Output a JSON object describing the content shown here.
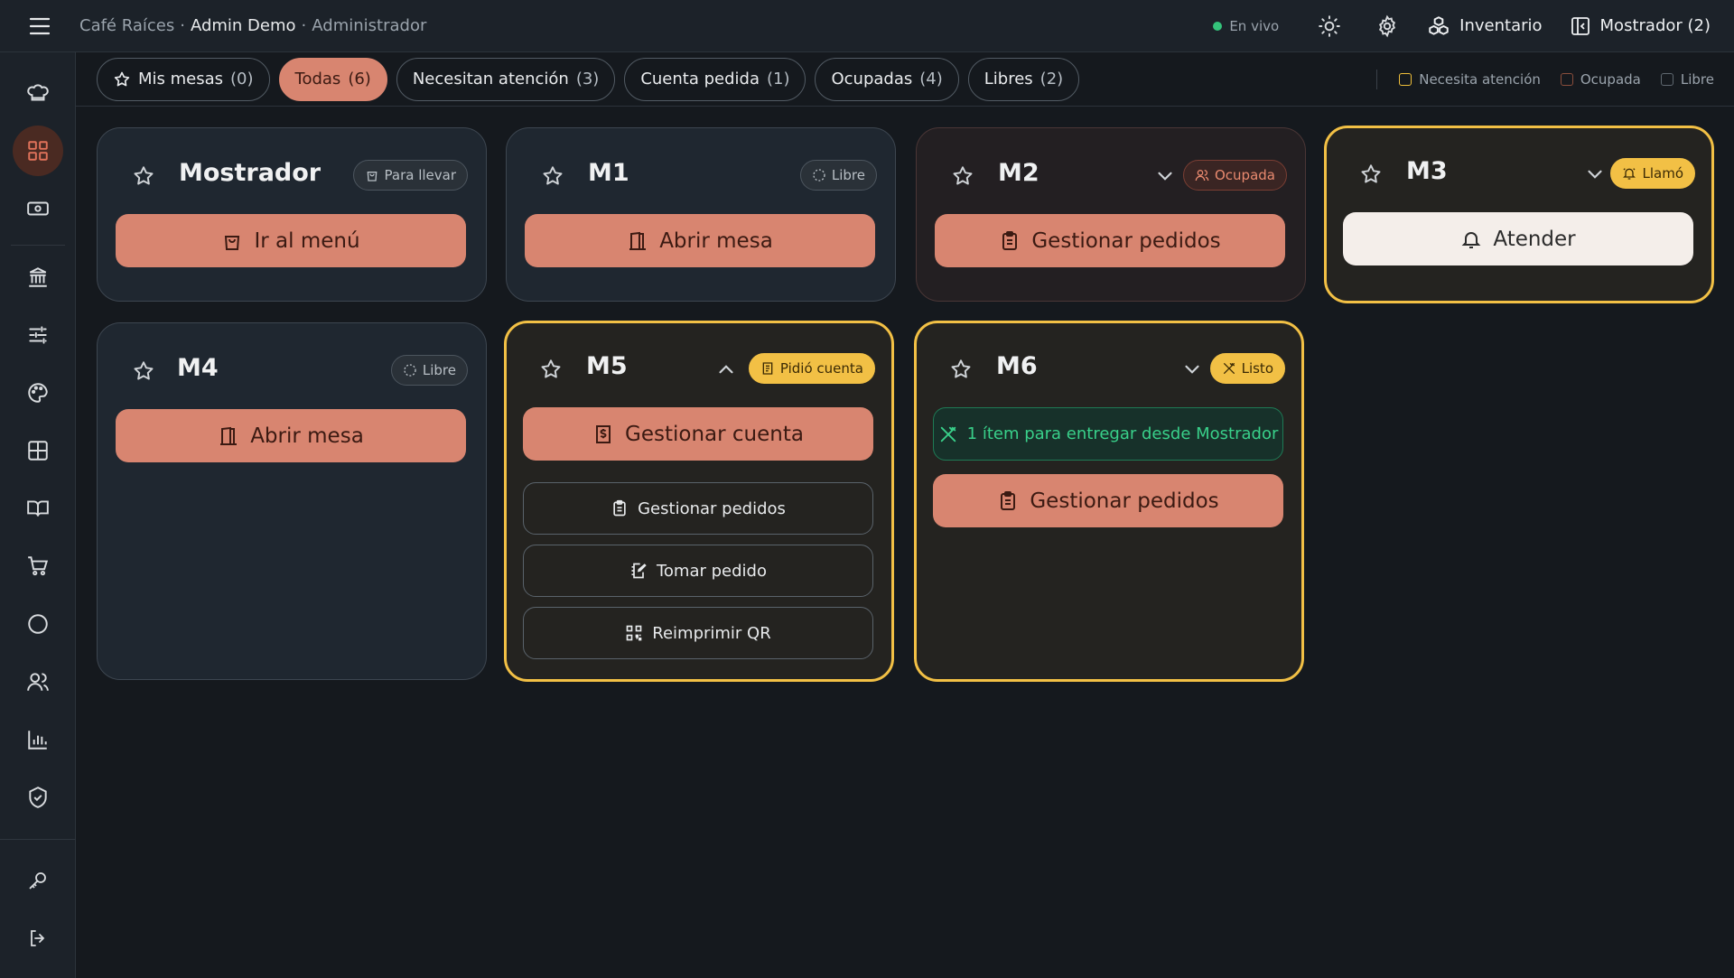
{
  "header": {
    "venue": "Café Raíces",
    "sep1": "·",
    "user": "Admin Demo",
    "sep2": "·",
    "role": "Administrador",
    "live": "En vivo",
    "inventory": "Inventario",
    "counter": "Mostrador (2)"
  },
  "filters": [
    {
      "label": "Mis mesas",
      "count": "(0)"
    },
    {
      "label": "Todas",
      "count": "(6)"
    },
    {
      "label": "Necesitan atención",
      "count": "(3)"
    },
    {
      "label": "Cuenta pedida",
      "count": "(1)"
    },
    {
      "label": "Ocupadas",
      "count": "(4)"
    },
    {
      "label": "Libres",
      "count": "(2)"
    }
  ],
  "legend": {
    "attention": "Necesita atención",
    "occupied": "Ocupada",
    "free": "Libre"
  },
  "tables": {
    "mostrador": {
      "name": "Mostrador",
      "badge": "Para llevar",
      "action": "Ir al menú"
    },
    "m1": {
      "name": "M1",
      "badge": "Libre",
      "action": "Abrir mesa"
    },
    "m2": {
      "name": "M2",
      "badge": "Ocupada",
      "action": "Gestionar pedidos"
    },
    "m3": {
      "name": "M3",
      "badge": "Llamó",
      "action": "Atender"
    },
    "m4": {
      "name": "M4",
      "badge": "Libre",
      "action": "Abrir mesa"
    },
    "m5": {
      "name": "M5",
      "badge": "Pidió cuenta",
      "action": "Gestionar cuenta",
      "sub1": "Gestionar pedidos",
      "sub2": "Tomar pedido",
      "sub3": "Reimprimir QR"
    },
    "m6": {
      "name": "M6",
      "badge": "Listo",
      "notice": "1 ítem para entregar desde Mostrador",
      "action": "Gestionar pedidos"
    }
  },
  "colors": {
    "accent": "#d88570",
    "attention": "#f2c045",
    "success": "#39d08a",
    "background": "#15191e"
  }
}
